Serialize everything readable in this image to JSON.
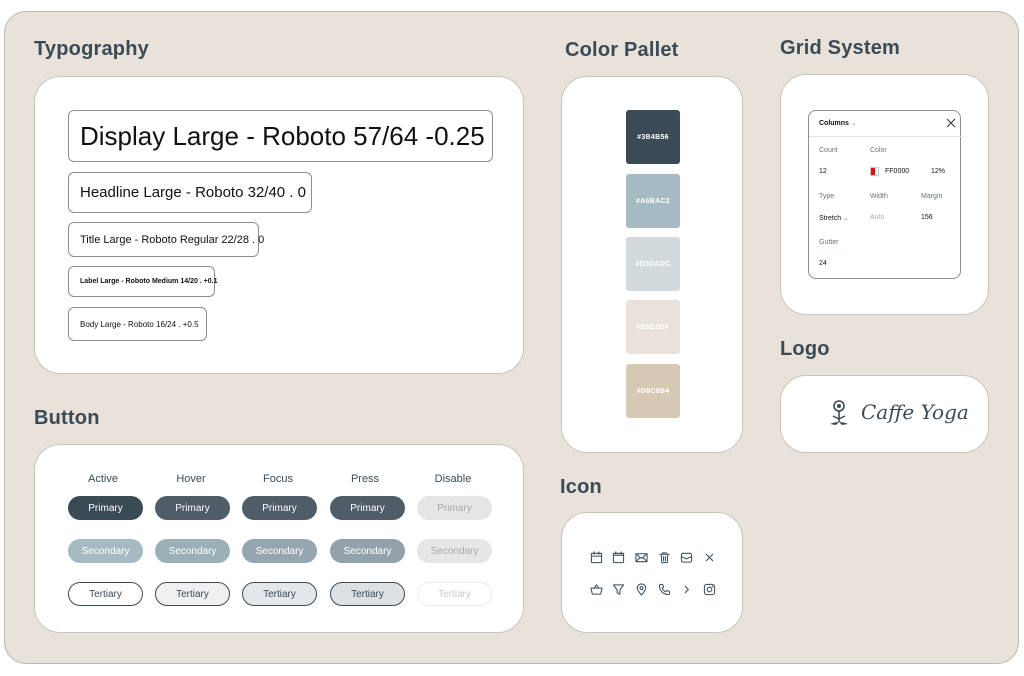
{
  "sections": {
    "typography": "Typography",
    "color": "Color Pallet",
    "grid": "Grid System",
    "logo": "Logo",
    "button": "Button",
    "icon": "Icon"
  },
  "typography": {
    "display": "Display Large - Roboto 57/64 -0.25",
    "headline": "Headline Large - Roboto 32/40 . 0",
    "title": "Title Large - Roboto Regular 22/28 . 0",
    "label": "Label Large - Roboto Medium 14/20 . +0.1",
    "body": "Body Large - Roboto 16/24 . +0.5"
  },
  "palette": [
    {
      "hex": "#3B4B56",
      "label": "#3B4B56",
      "text_color": "#ffffff"
    },
    {
      "hex": "#A6BAC2",
      "label": "#A6BAC2",
      "text_color": "#ffffff"
    },
    {
      "hex": "#D3DADC",
      "label": "#D3DADC",
      "text_color": "#ffffff"
    },
    {
      "hex": "#E8E2DA",
      "label": "#E8E2DA",
      "text_color": "#ffffff"
    },
    {
      "hex": "#D6C9B4",
      "label": "#D6C9B4",
      "text_color": "#ffffff"
    }
  ],
  "grid": {
    "header": "Columns",
    "count_label": "Count",
    "count_value": "12",
    "color_label": "Color",
    "color_value": "FF0000",
    "color_swatch": "#FF0000",
    "opacity_value": "12%",
    "type_label": "Type",
    "type_value": "Stretch",
    "width_label": "Width",
    "width_value": "Auto",
    "margin_label": "Margin",
    "margin_value": "156",
    "gutter_label": "Gutter",
    "gutter_value": "24"
  },
  "logo": {
    "text": "Caffe Yoga"
  },
  "buttons": {
    "states": [
      "Active",
      "Hover",
      "Focus",
      "Press",
      "Disable"
    ],
    "primary": "Primary",
    "secondary": "Secondary",
    "tertiary": "Tertiary"
  },
  "icons": {
    "row1": [
      "calendar-icon",
      "calendar-alt-icon",
      "mail-icon",
      "trash-icon",
      "inbox-icon",
      "close-icon"
    ],
    "row2": [
      "basket-icon",
      "filter-icon",
      "location-pin-icon",
      "phone-icon",
      "chevron-right-icon",
      "instagram-icon"
    ]
  },
  "colors": {
    "primary": "#3B4B56",
    "secondary": "#A6BAC2",
    "light": "#D3DADC",
    "cream": "#E8E2DA",
    "sand": "#D6C9B4"
  }
}
